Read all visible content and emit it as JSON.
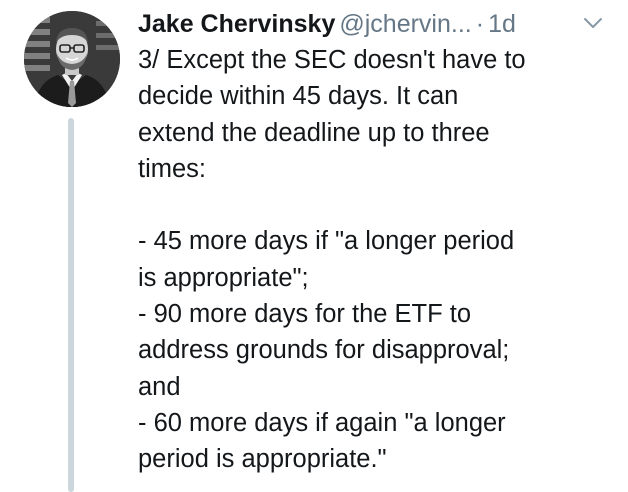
{
  "author": {
    "name": "Jake Chervinsky",
    "handle": "@jchervin...",
    "separator": "·",
    "time": "1d"
  },
  "icons": {
    "menu": "chevron-down-icon",
    "avatar": "avatar"
  },
  "colors": {
    "text": "#14171a",
    "secondary": "#657786",
    "thread_line": "#ccd6dd"
  },
  "tweet": {
    "line1": "3/ Except the SEC doesn't have to",
    "line2": "decide within 45 days. It can",
    "line3": "extend the deadline up to three",
    "line4": "times:",
    "line5": "- 45 more days if \"a longer period",
    "line6": "is appropriate\";",
    "line7": "- 90 more days for the ETF to",
    "line8": "address grounds for disapproval;",
    "line9": "and",
    "line10": "- 60 more days if again \"a longer",
    "line11": "period is appropriate.\""
  }
}
